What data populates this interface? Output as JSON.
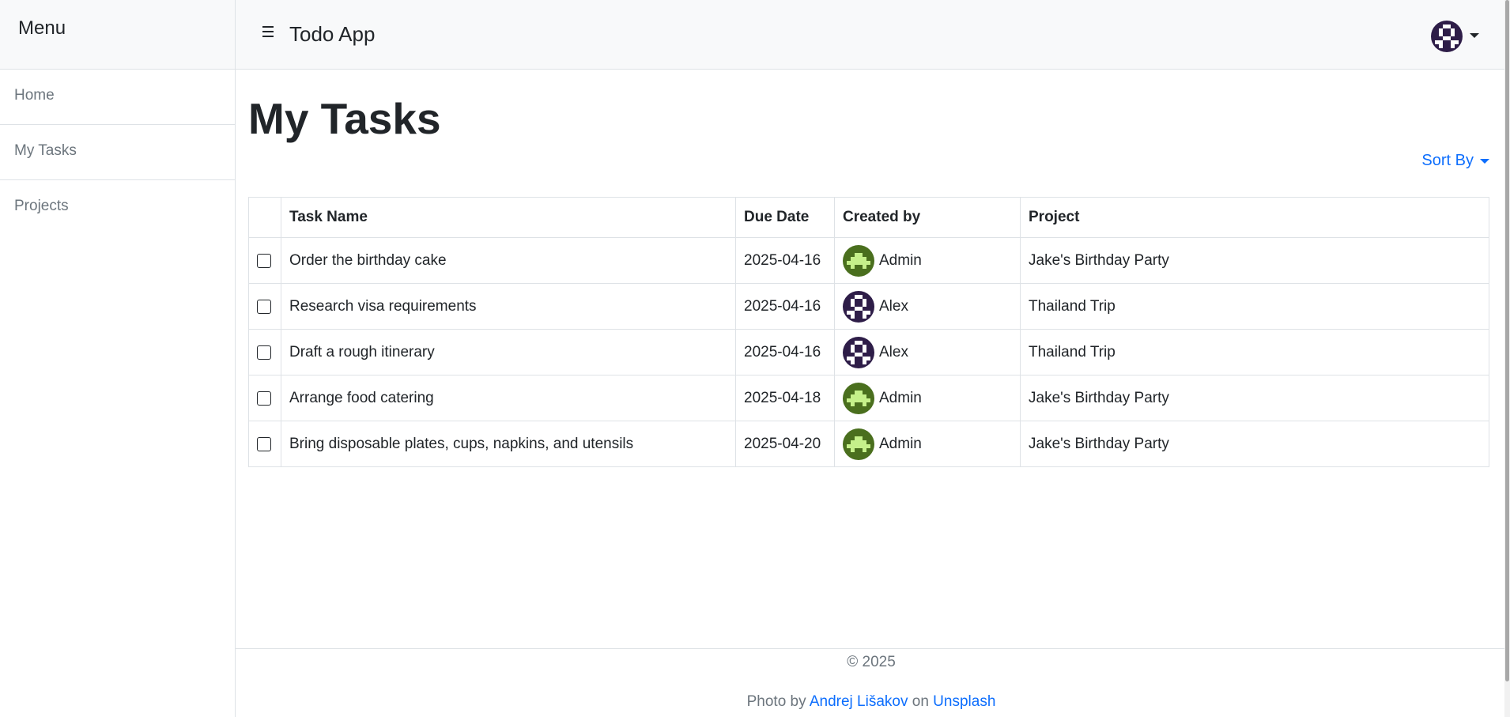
{
  "sidebar": {
    "heading": "Menu",
    "items": [
      {
        "label": "Home"
      },
      {
        "label": "My Tasks"
      },
      {
        "label": "Projects"
      }
    ]
  },
  "navbar": {
    "title": "Todo App",
    "user_avatar": "alex-avatar-icon"
  },
  "main": {
    "title": "My Tasks",
    "sort_label": "Sort By",
    "columns": [
      "Task Name",
      "Due Date",
      "Created by",
      "Project"
    ],
    "tasks": [
      {
        "name": "Order the birthday cake",
        "due": "2025-04-16",
        "creator": "Admin",
        "project": "Jake's Birthday Party",
        "done": false
      },
      {
        "name": "Research visa requirements",
        "due": "2025-04-16",
        "creator": "Alex",
        "project": "Thailand Trip",
        "done": false
      },
      {
        "name": "Draft a rough itinerary",
        "due": "2025-04-16",
        "creator": "Alex",
        "project": "Thailand Trip",
        "done": false
      },
      {
        "name": "Arrange food catering",
        "due": "2025-04-18",
        "creator": "Admin",
        "project": "Jake's Birthday Party",
        "done": false
      },
      {
        "name": "Bring disposable plates, cups, napkins, and utensils",
        "due": "2025-04-20",
        "creator": "Admin",
        "project": "Jake's Birthday Party",
        "done": false
      }
    ]
  },
  "footer": {
    "copyright": "© 2025",
    "photo_prefix": "Photo by",
    "photographer": "Andrej Lišakov",
    "on_word": "on",
    "site": "Unsplash"
  },
  "colors": {
    "accent": "#0d6efd",
    "admin_avatar_bg": "#4a6f1e",
    "admin_avatar_fg": "#c5f08a",
    "alex_avatar_bg": "#2e1d48",
    "alex_avatar_fg": "#ffffff"
  }
}
